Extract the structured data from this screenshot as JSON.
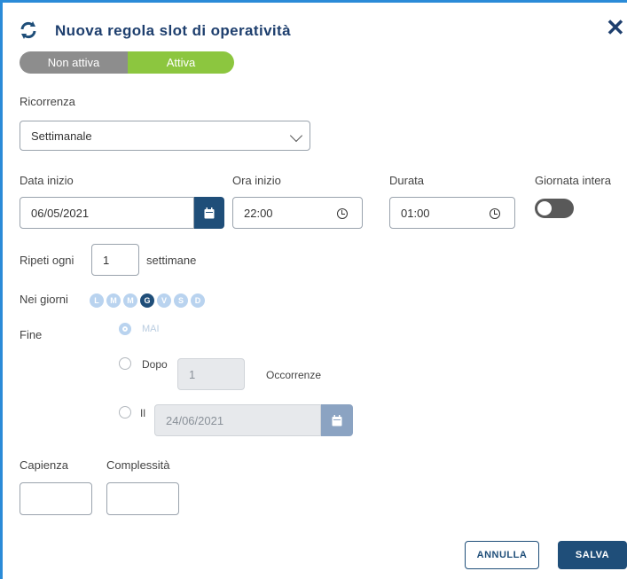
{
  "dialog": {
    "title": "Nuova regola slot di operatività",
    "close_icon": "close-icon",
    "title_icon": "refresh-icon"
  },
  "status_toggle": {
    "inactive_label": "Non attiva",
    "active_label": "Attiva",
    "selected": "Attiva"
  },
  "recurrence": {
    "label": "Ricorrenza",
    "value": "Settimanale"
  },
  "start_date": {
    "label": "Data inizio",
    "value": "06/05/2021"
  },
  "start_time": {
    "label": "Ora inizio",
    "value": "22:00"
  },
  "duration": {
    "label": "Durata",
    "value": "01:00"
  },
  "full_day": {
    "label": "Giornata intera",
    "enabled": false
  },
  "repeat": {
    "label": "Ripeti ogni",
    "value": "1",
    "unit": "settimane"
  },
  "days": {
    "label": "Nei giorni",
    "items": [
      {
        "letter": "L",
        "selected": false
      },
      {
        "letter": "M",
        "selected": false
      },
      {
        "letter": "M",
        "selected": false
      },
      {
        "letter": "G",
        "selected": true
      },
      {
        "letter": "V",
        "selected": false
      },
      {
        "letter": "S",
        "selected": false
      },
      {
        "letter": "D",
        "selected": false
      }
    ]
  },
  "end": {
    "label": "Fine",
    "never_label": "MAI",
    "after_label": "Dopo",
    "after_value": "1",
    "after_unit": "Occorrenze",
    "on_label": "Il",
    "on_value": "24/06/2021",
    "selected": "MAI"
  },
  "capacity": {
    "label": "Capienza",
    "value": ""
  },
  "complexity": {
    "label": "Complessità",
    "value": ""
  },
  "actions": {
    "cancel_label": "ANNULLA",
    "save_label": "SALVA"
  },
  "colors": {
    "primary": "#1f4e79",
    "active_green": "#8cc63f",
    "inactive_gray": "#8d8d8d",
    "frame_blue": "#2a8bd8"
  }
}
